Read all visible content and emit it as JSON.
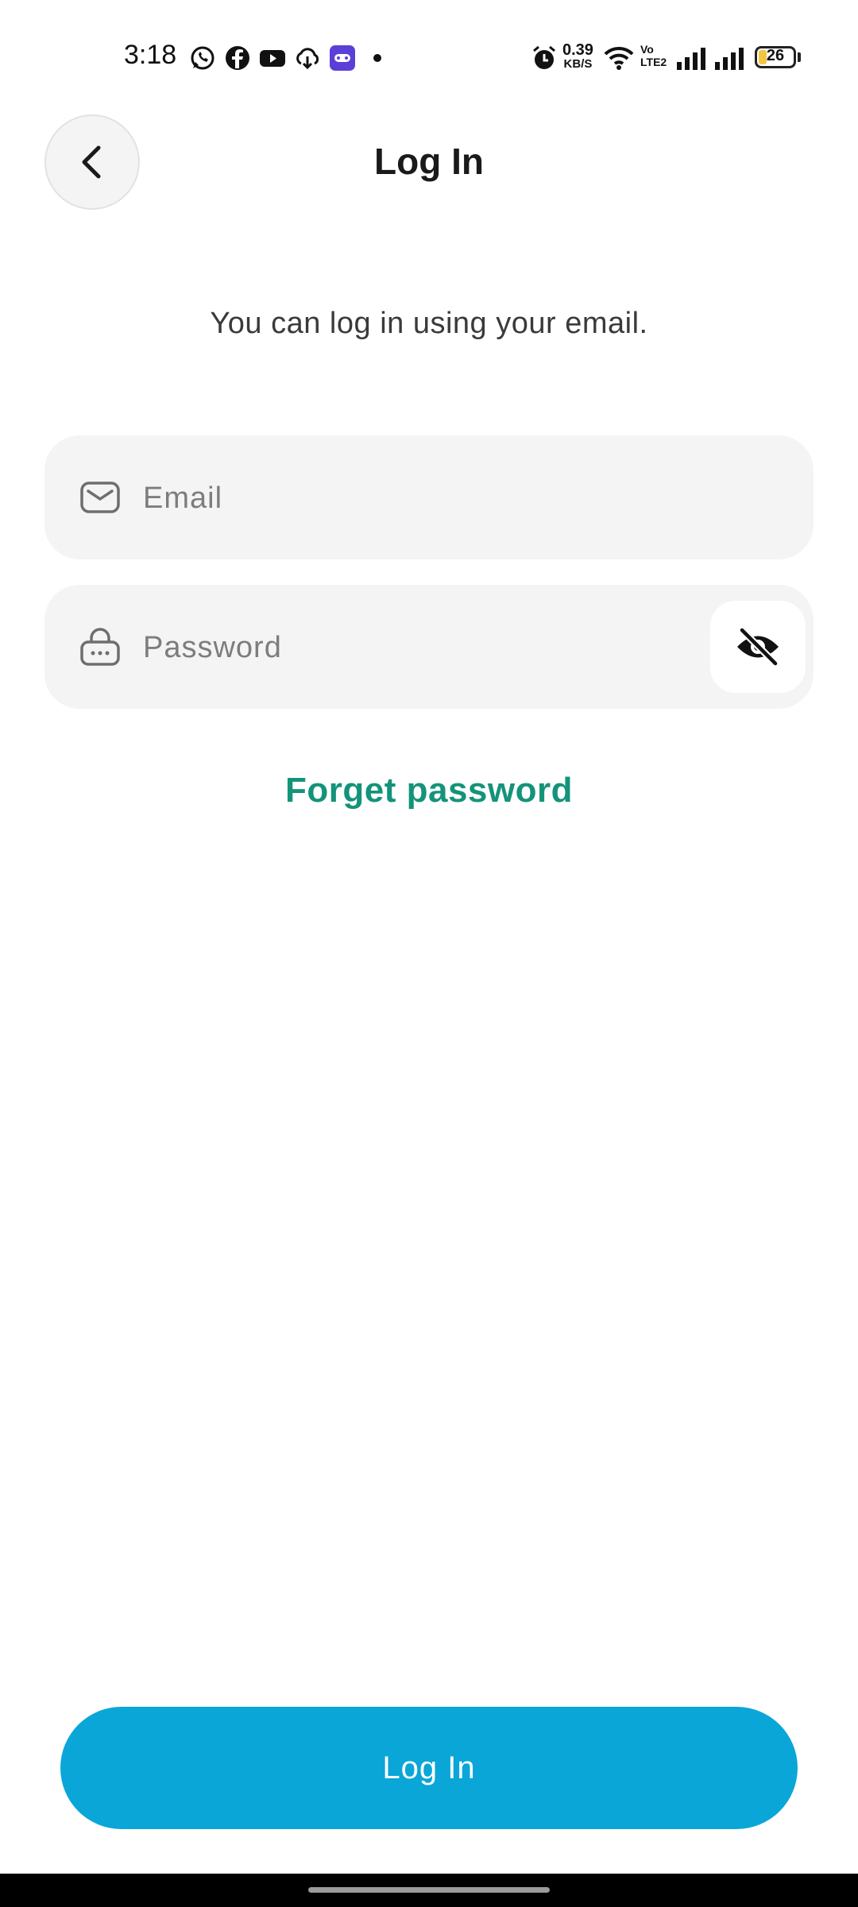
{
  "status_bar": {
    "time": "3:18",
    "net_speed_value": "0.39",
    "net_speed_unit": "KB/S",
    "volte_label": "Vo LTE2",
    "battery_level": "26",
    "icons": [
      "whatsapp-icon",
      "facebook-icon",
      "youtube-icon",
      "cloud-download-icon",
      "app-icon",
      "dot-icon",
      "alarm-icon",
      "wifi-icon",
      "signal-icon",
      "signal-icon",
      "battery-icon"
    ]
  },
  "header": {
    "back_icon": "chevron-left-icon",
    "title": "Log In"
  },
  "subtitle": "You can log in using your email.",
  "email_field": {
    "icon": "mail-icon",
    "placeholder": "Email",
    "value": ""
  },
  "password_field": {
    "icon": "lock-icon",
    "placeholder": "Password",
    "value": "",
    "toggle_icon": "eye-off-icon"
  },
  "forgot_password_label": "Forget password",
  "login_button_label": "Log In",
  "colors": {
    "accent_link": "#13937a",
    "primary_button": "#0aa6d8",
    "field_background": "#f4f4f4"
  }
}
